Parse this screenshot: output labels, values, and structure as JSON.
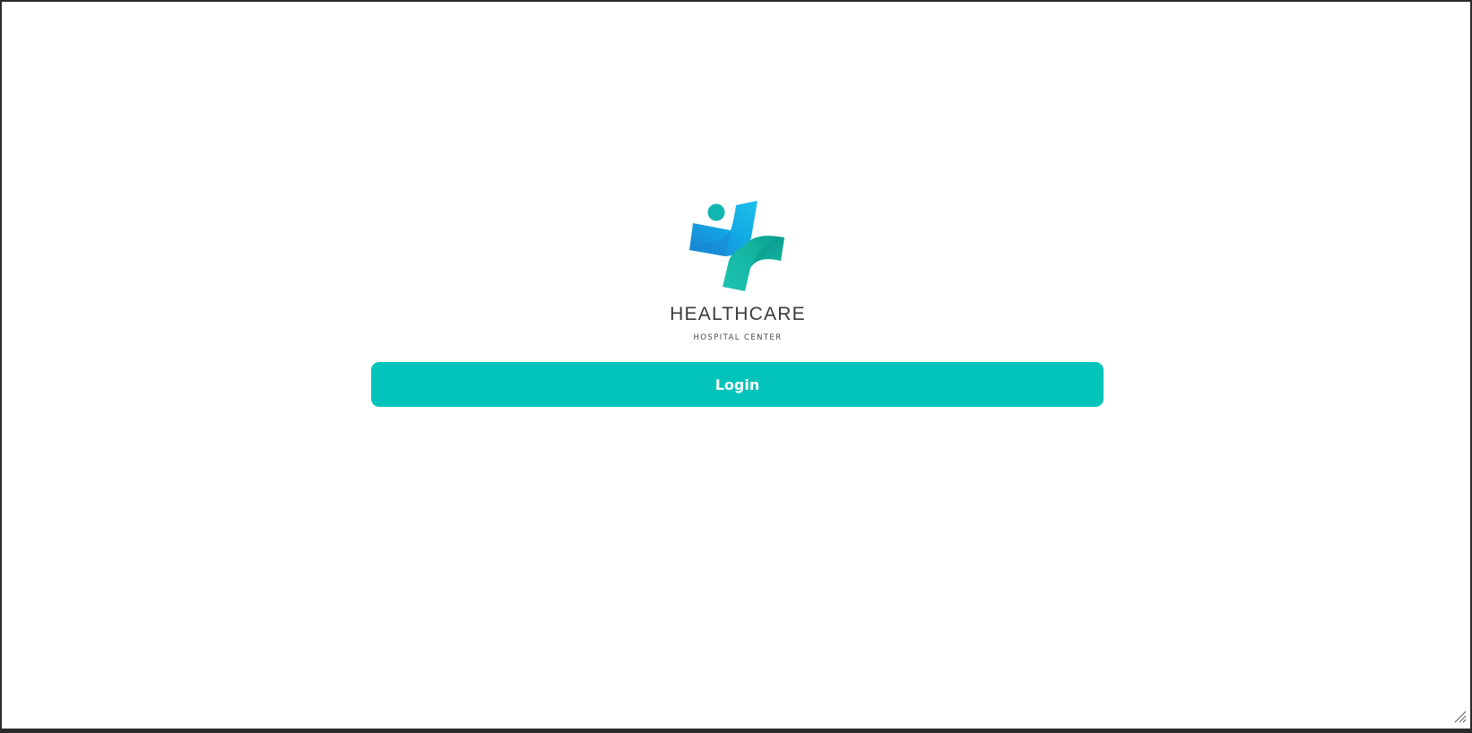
{
  "app": {
    "logo_icon": "medical-cross-person-icon",
    "brand_name": "HEALTHCARE",
    "brand_tagline": "HOSPITAL CENTER"
  },
  "actions": {
    "login_label": "Login"
  },
  "colors": {
    "accent": "#02c4bb",
    "logo_blue": "#1aa6e6",
    "logo_teal": "#16bba8",
    "text_dark": "#3a3a3a",
    "frame": "#2b2b2b"
  },
  "window": {
    "resize_icon": "resize-grip-icon"
  }
}
